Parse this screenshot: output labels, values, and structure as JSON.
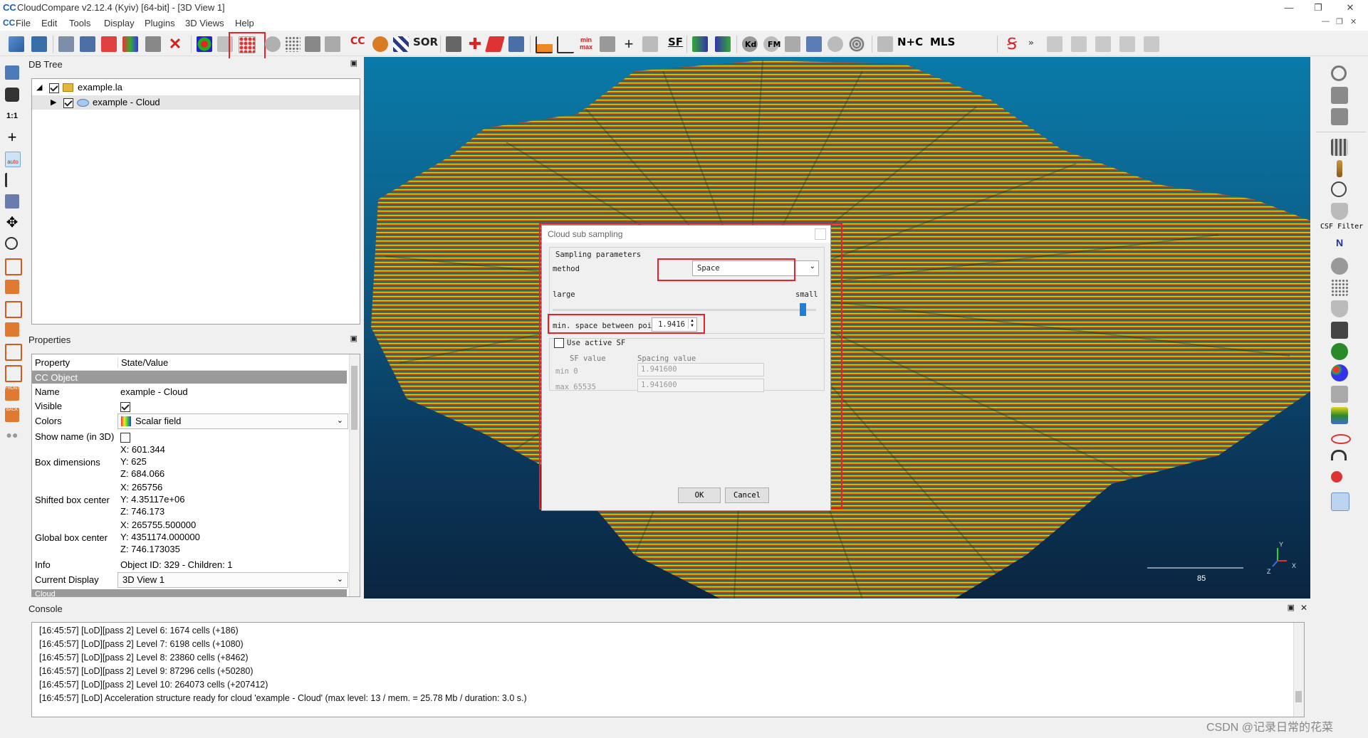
{
  "window": {
    "app_logo": "CC",
    "title": "CloudCompare v2.12.4 (Kyiv) [64-bit] - [3D View 1]",
    "minimize_glyph": "—",
    "restore_glyph": "❐",
    "close_glyph": "✕"
  },
  "menu": {
    "items": [
      "File",
      "Edit",
      "Tools",
      "Display",
      "Plugins",
      "3D Views",
      "Help"
    ],
    "mdi_controls": [
      "—",
      "❐",
      "✕"
    ]
  },
  "toolbar": {
    "text_buttons": [
      "SOR",
      "SF",
      "Kd",
      "FM",
      "N+C",
      "MLS"
    ],
    "more_glyph": "»"
  },
  "left_toolbar": {
    "ratio_label": "1:1",
    "auto_label": "auto",
    "front_label": "FRONT",
    "back_label": "BACK"
  },
  "db_tree": {
    "header": "DB Tree",
    "items": [
      {
        "label": "example.la",
        "checked": true,
        "expanded": true,
        "icon": "folder-icon"
      },
      {
        "label": "example - Cloud",
        "checked": true,
        "expanded": false,
        "icon": "cloud-icon"
      }
    ]
  },
  "properties": {
    "header": "Properties",
    "col_property": "Property",
    "col_value": "State/Value",
    "section": "CC Object",
    "name_key": "Name",
    "name_value": "example - Cloud",
    "visible_key": "Visible",
    "colors_key": "Colors",
    "colors_value": "Scalar field",
    "show_name_key": "Show name (in 3D)",
    "box_dim_key": "Box dimensions",
    "box_dim": [
      "X: 601.344",
      "Y: 625",
      "Z: 684.066"
    ],
    "shifted_key": "Shifted box center",
    "shifted": [
      "X: 265756",
      "Y: 4.35117e+06",
      "Z: 746.173"
    ],
    "global_key": "Global box center",
    "global": [
      "X: 265755.500000",
      "Y: 4351174.000000",
      "Z: 746.173035"
    ],
    "info_key": "Info",
    "info_value": "Object ID: 329 - Children: 1",
    "display_key": "Current Display",
    "display_value": "3D View 1",
    "next_section": "Cloud"
  },
  "view3d": {
    "scale_label": "85",
    "axis_labels": [
      "Z",
      "Y",
      "X"
    ]
  },
  "dialog": {
    "title": "Cloud sub sampling",
    "group_label": "Sampling parameters",
    "method_label": "method",
    "method_value": "Space",
    "large_label": "large",
    "small_label": "small",
    "slider_level": 0.95,
    "min_space_label": "min. space between points",
    "min_space_value": "1.9416",
    "use_sf_label": "Use active SF",
    "sf_value_label": "SF value",
    "spacing_value_label": "Spacing value",
    "min_label": "min 0",
    "max_label": "max 65535",
    "min_spacing": "1.941600",
    "max_spacing": "1.941600",
    "ok_label": "OK",
    "cancel_label": "Cancel"
  },
  "right_toolbar": {
    "csf_label": "CSF Filter",
    "n_label": "N"
  },
  "console": {
    "header": "Console",
    "lines": [
      "[16:45:57] [LoD][pass 2] Level 6: 1674 cells (+186)",
      "[16:45:57] [LoD][pass 2] Level 7: 6198 cells (+1080)",
      "[16:45:57] [LoD][pass 2] Level 8: 23860 cells (+8462)",
      "[16:45:57] [LoD][pass 2] Level 9: 87296 cells (+50280)",
      "[16:45:57] [LoD][pass 2] Level 10: 264073 cells (+207412)",
      "[16:45:57] [LoD] Acceleration structure ready for cloud 'example - Cloud' (max level: 13 / mem. = 25.78 Mb / duration: 3.0 s.)"
    ]
  },
  "watermark": "CSDN @记录日常的花菜",
  "colors": {
    "highlight_red": "#e8202a",
    "view_bg_top": "#0a7aa8",
    "view_bg_bottom": "#0a2540",
    "section_gray": "#9a9a9a"
  }
}
